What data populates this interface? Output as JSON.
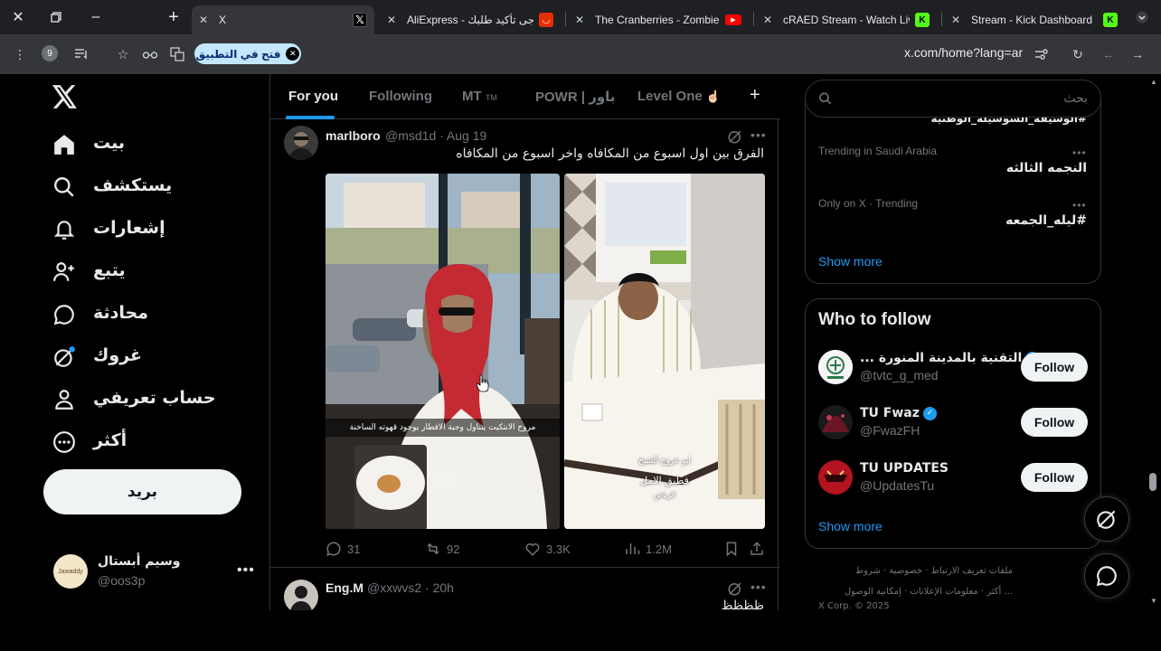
{
  "browser": {
    "tabs": [
      {
        "title": "X",
        "favicon": "x-logo",
        "active": true
      },
      {
        "title": "AliExpress - يرجى تأكيد طلبك",
        "favicon": "aliexpress-icon"
      },
      {
        "title": "The Cranberries - Zombie -",
        "favicon": "youtube-icon"
      },
      {
        "title": "cRAED Stream - Watch Live",
        "favicon": "kick-icon"
      },
      {
        "title": "Stream - Kick Dashboard",
        "favicon": "kick-icon"
      }
    ],
    "profile_badge": "9",
    "open_in_app_label": "فتح في التطبيق",
    "url": "x.com/home?lang=ar"
  },
  "sidebar": {
    "items": [
      {
        "label": "بيت",
        "icon": "home-icon"
      },
      {
        "label": "يستكشف",
        "icon": "search-icon"
      },
      {
        "label": "إشعارات",
        "icon": "bell-icon"
      },
      {
        "label": "يتبع",
        "icon": "person-add-icon"
      },
      {
        "label": "محادثة",
        "icon": "chat-icon"
      },
      {
        "label": "غروك",
        "icon": "grok-icon"
      },
      {
        "label": "حساب تعريفي",
        "icon": "person-icon"
      },
      {
        "label": "أكثر",
        "icon": "more-circle-icon"
      }
    ],
    "post_button": "بريد",
    "profile": {
      "name": "وسيم أبستال",
      "handle": "@oos3p",
      "avatar_text": "Jawaddy"
    }
  },
  "feed": {
    "tabs": [
      "For you",
      "Following",
      "MT",
      "POWR | باور",
      "Level One"
    ],
    "mt_suffix": "TM",
    "level_one_emoji": "☝🏻",
    "tweets": [
      {
        "name": "marlboro",
        "handle": "@msd1d",
        "time": "Aug 19",
        "text": "الفرق بين اول اسبوع من المكافاه واخر اسبوع من المكافاه",
        "image_captions": [
          "مروح الانتكيت يتناول وجبة الافطار يوجود قهوته الساخنة",
          "ابو عروج الشيخ",
          "فطبق الامل",
          "الرياض"
        ],
        "stats": {
          "replies": "31",
          "reposts": "92",
          "likes": "3.3K",
          "views": "1.2M"
        }
      },
      {
        "name": "Eng.M",
        "handle": "@xxwvs2",
        "time": "20h",
        "text": "ظظظظ"
      }
    ]
  },
  "right": {
    "search_placeholder": "بحث",
    "trending": [
      {
        "meta": "",
        "title": "#الوشيفة_السوشيلة_الوطنية"
      },
      {
        "meta": "Trending in Saudi Arabia",
        "title": "النجمه الثالثه"
      },
      {
        "meta": "Only on X · Trending",
        "title": "#ليله_الجمعه"
      }
    ],
    "show_more": "Show more",
    "who_to_follow": {
      "title": "Who to follow",
      "accounts": [
        {
          "name": "... التقنية بالمدينة المنورة",
          "handle": "@tvtc_g_med",
          "verified": true,
          "follow": "Follow"
        },
        {
          "name": "TU Fwaz",
          "handle": "@FwazFH",
          "verified": true,
          "follow": "Follow"
        },
        {
          "name": "TU UPDATES",
          "handle": "@UpdatesTu",
          "verified": false,
          "follow": "Follow"
        }
      ],
      "show_more": "Show more"
    },
    "footer": {
      "line1": "ملفات تعريف الارتباط · خصوصية · شروط",
      "line2": "... أكثر · معلومات الإعلانات · إمكانية الوصول",
      "line3": "X Corp. © 2025"
    }
  },
  "colors": {
    "accent": "#1d9bf0",
    "background": "#000000",
    "chrome": "#35363a",
    "tabbar": "#1f2023"
  }
}
